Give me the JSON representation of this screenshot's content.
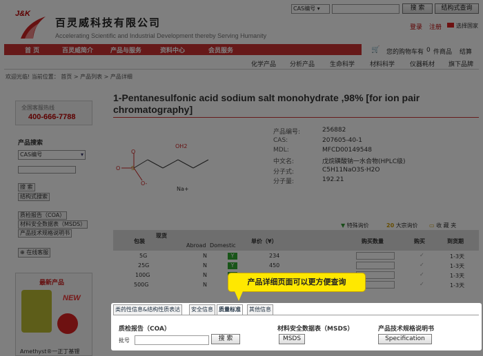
{
  "brand": {
    "jk": "J&K",
    "company": "百灵威科技有限公司",
    "slogan": "Accelerating Scientific and Industrial Development thereby Serving Humanity"
  },
  "topbar": {
    "cas_select": "CAS编号",
    "search_btn": "搜 索",
    "struct_btn": "结构式查询",
    "login": "登录",
    "register": "注册",
    "country": "选择国家"
  },
  "nav": [
    "首 页",
    "百灵威简介",
    "产品与服务",
    "资料中心",
    "会员服务"
  ],
  "cart": {
    "text": "您的购物车有",
    "count": "0",
    "unit": "件商品",
    "checkout": "结算"
  },
  "subnav": [
    "化学产品",
    "分析产品",
    "生命科学",
    "材料科学",
    "仪器耗材",
    "旗下品牌"
  ],
  "breadcrumb": "欢迎光临! 当前位置： 首页 > 产品列表 > 产品详细",
  "sidebar": {
    "hotline_label": "全国客服热线",
    "hotline": "400-666-7788",
    "search_title": "产品搜索",
    "search_select": "CAS编号",
    "search_btn": "搜 索",
    "struct_btn": "结构式搜索",
    "links": [
      "质检报告（COA）",
      "材料安全数据表（MSDS）",
      "产品技术规格说明书"
    ],
    "online_service": "在线客服",
    "new_title": "最新产品",
    "new_badge": "NEW",
    "new_caption": "Amethyst®一正丁基锂"
  },
  "product": {
    "title": "1-Pentanesulfonic acid sodium salt monohydrate ,98% [for ion pair chromatography]",
    "structure_labels": {
      "oh2": "OH2",
      "o1": "O",
      "o2": "O",
      "s": "S",
      "ominus": "O-",
      "na": "Na+"
    },
    "props": [
      {
        "label": "产品编号:",
        "value": "256882"
      },
      {
        "label": "CAS:",
        "value": "207605-40-1"
      },
      {
        "label": "MDL:",
        "value": "MFCD00149548"
      },
      {
        "label": "中文名:",
        "value": "戊烷磺酸钠一水合物(HPLC级)"
      },
      {
        "label": "分子式:",
        "value": "C5H11NaO3S·H2O"
      },
      {
        "label": "分子量:",
        "value": "192.21"
      }
    ],
    "actions": [
      "特殊询价",
      "大宗询价",
      "收 藏 夹"
    ]
  },
  "table": {
    "headers": {
      "pack": "包装",
      "stock": "现货",
      "abroad": "Abroad",
      "domestic": "Domestic",
      "price": "单价（¥）",
      "qty": "购买数量",
      "buy": "购买",
      "arrival": "到货期"
    },
    "rows": [
      {
        "pack": "5G",
        "abroad": "N",
        "domestic": "Y",
        "price": "234",
        "arrival": "1-3天"
      },
      {
        "pack": "25G",
        "abroad": "N",
        "domestic": "Y",
        "price": "450",
        "arrival": "1-3天"
      },
      {
        "pack": "100G",
        "abroad": "N",
        "domestic": "Y",
        "price": "",
        "arrival": "1-3天"
      },
      {
        "pack": "500G",
        "abroad": "N",
        "domestic": "Y",
        "price": "",
        "arrival": "1-3天"
      }
    ]
  },
  "tooltip": "产品详细页面可以更方便查询",
  "tabs": [
    "类药性信息&结构性质表达",
    "安全信息",
    "质量标准",
    "其他信息"
  ],
  "quality": {
    "coa_title": "质检报告（COA）",
    "batch_label": "批号",
    "batch_placeholder": "",
    "search_btn": "搜 索",
    "msds_title": "材料安全数据表（MSDS）",
    "msds_btn": "MSDS",
    "spec_title": "产品技术规格说明书",
    "spec_btn": "Specification"
  },
  "colors": {
    "brand_red": "#cc3333",
    "tooltip_yellow": "#ffe800",
    "stock_green": "#33aa33"
  }
}
